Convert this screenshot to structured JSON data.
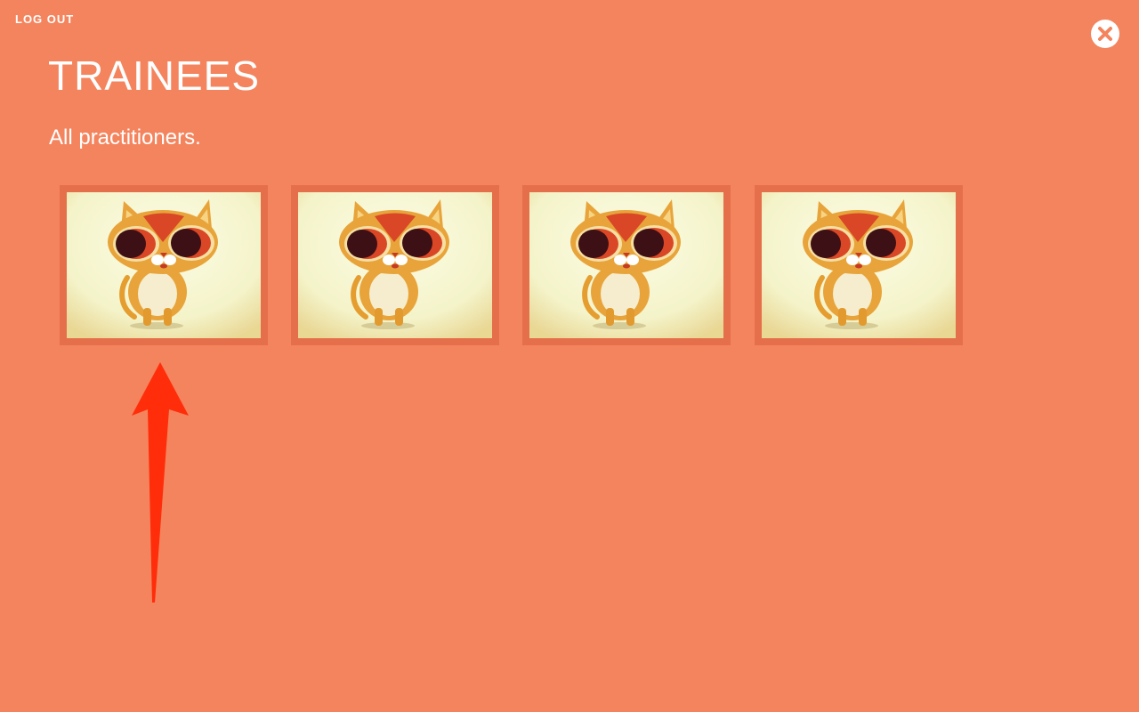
{
  "header": {
    "logout_label": "LOG OUT",
    "close_icon": "close-icon"
  },
  "main": {
    "title": "TRAINEES",
    "subtitle": "All practitioners."
  },
  "trainees": [
    {
      "avatar": "cat-avatar"
    },
    {
      "avatar": "cat-avatar"
    },
    {
      "avatar": "cat-avatar"
    },
    {
      "avatar": "cat-avatar"
    }
  ],
  "annotation": {
    "icon": "arrow-up-icon",
    "color": "#ff2d0a"
  },
  "colors": {
    "background": "#f4845d",
    "card_border": "#e66f4b"
  }
}
